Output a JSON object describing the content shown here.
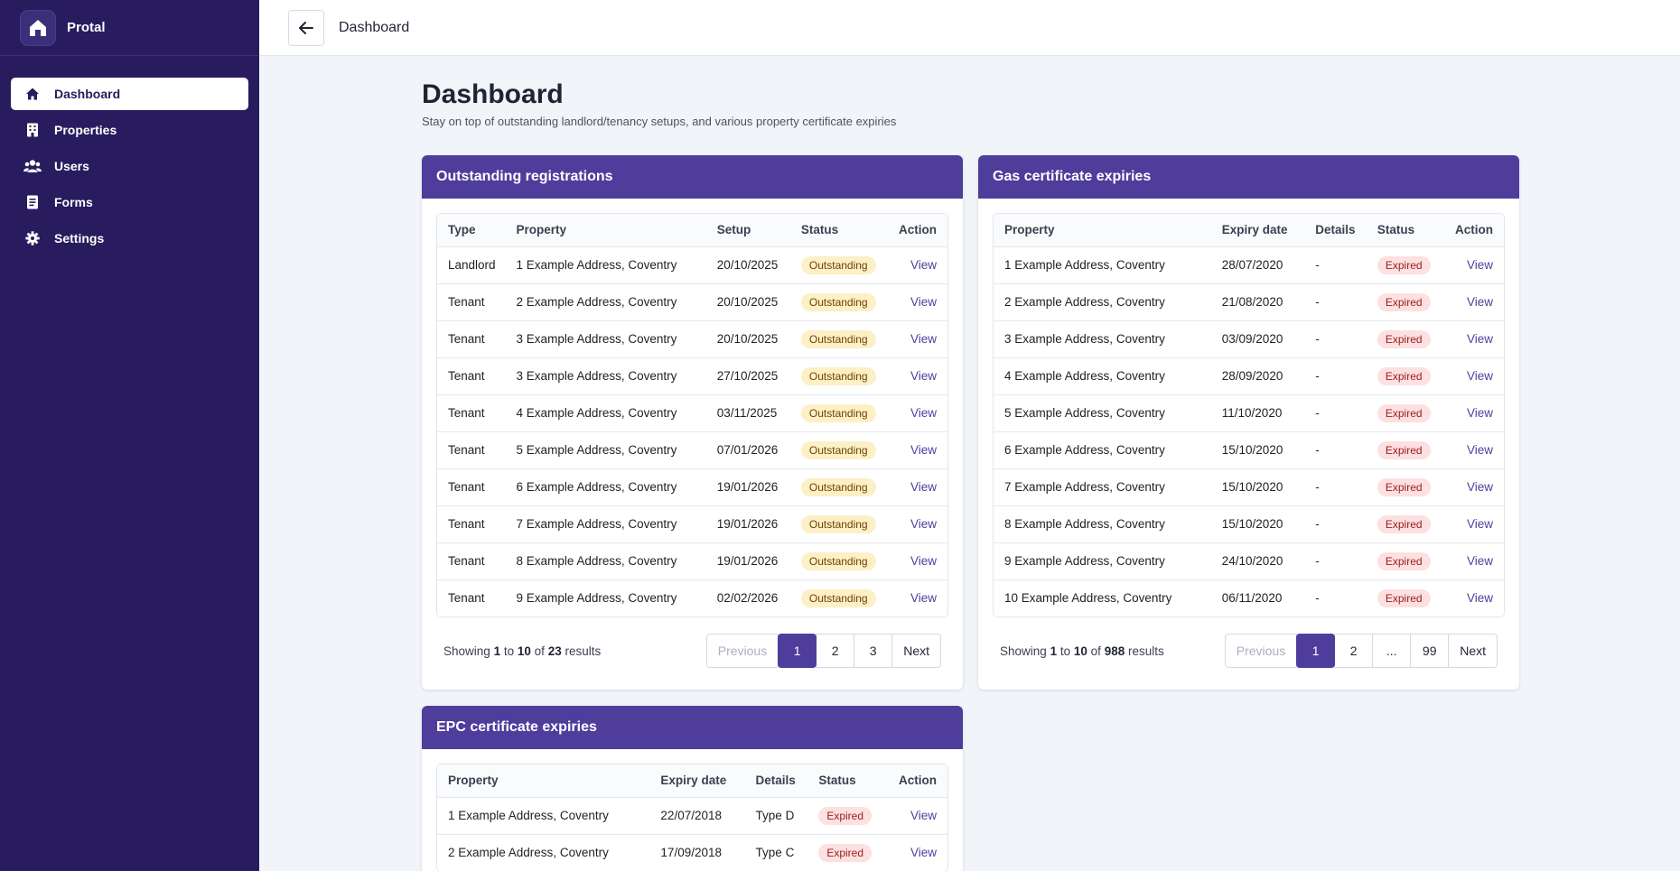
{
  "app": {
    "name": "Protal"
  },
  "sidebar": {
    "items": [
      {
        "label": "Dashboard",
        "icon": "home-icon"
      },
      {
        "label": "Properties",
        "icon": "building-icon"
      },
      {
        "label": "Users",
        "icon": "users-icon"
      },
      {
        "label": "Forms",
        "icon": "form-icon"
      },
      {
        "label": "Settings",
        "icon": "gear-icon"
      }
    ]
  },
  "topbar": {
    "title": "Dashboard"
  },
  "page": {
    "title": "Dashboard",
    "subtitle": "Stay on top of outstanding landlord/tenancy setups, and various property certificate expiries"
  },
  "registrations": {
    "title": "Outstanding registrations",
    "headers": [
      "Type",
      "Property",
      "Setup",
      "Status",
      "Action"
    ],
    "rows": [
      [
        "Landlord",
        "1 Example Address, Coventry",
        "20/10/2025",
        "Outstanding",
        "View"
      ],
      [
        "Tenant",
        "2 Example Address, Coventry",
        "20/10/2025",
        "Outstanding",
        "View"
      ],
      [
        "Tenant",
        "3 Example Address, Coventry",
        "20/10/2025",
        "Outstanding",
        "View"
      ],
      [
        "Tenant",
        "3 Example Address, Coventry",
        "27/10/2025",
        "Outstanding",
        "View"
      ],
      [
        "Tenant",
        "4 Example Address, Coventry",
        "03/11/2025",
        "Outstanding",
        "View"
      ],
      [
        "Tenant",
        "5 Example Address, Coventry",
        "07/01/2026",
        "Outstanding",
        "View"
      ],
      [
        "Tenant",
        "6 Example Address, Coventry",
        "19/01/2026",
        "Outstanding",
        "View"
      ],
      [
        "Tenant",
        "7 Example Address, Coventry",
        "19/01/2026",
        "Outstanding",
        "View"
      ],
      [
        "Tenant",
        "8 Example Address, Coventry",
        "19/01/2026",
        "Outstanding",
        "View"
      ],
      [
        "Tenant",
        "9 Example Address, Coventry",
        "02/02/2026",
        "Outstanding",
        "View"
      ]
    ],
    "footer": {
      "showing": "Showing",
      "from": "1",
      "to_word": "to",
      "to": "10",
      "of_word": "of",
      "total": "23",
      "results": "results"
    },
    "pager": [
      "Previous",
      "1",
      "2",
      "3",
      "Next"
    ]
  },
  "gas": {
    "title": "Gas certificate expiries",
    "headers": [
      "Property",
      "Expiry date",
      "Details",
      "Status",
      "Action"
    ],
    "rows": [
      [
        "1 Example Address, Coventry",
        "28/07/2020",
        "-",
        "Expired",
        "View"
      ],
      [
        "2 Example Address, Coventry",
        "21/08/2020",
        "-",
        "Expired",
        "View"
      ],
      [
        "3 Example Address, Coventry",
        "03/09/2020",
        "-",
        "Expired",
        "View"
      ],
      [
        "4 Example Address, Coventry",
        "28/09/2020",
        "-",
        "Expired",
        "View"
      ],
      [
        "5 Example Address, Coventry",
        "11/10/2020",
        "-",
        "Expired",
        "View"
      ],
      [
        "6 Example Address, Coventry",
        "15/10/2020",
        "-",
        "Expired",
        "View"
      ],
      [
        "7 Example Address, Coventry",
        "15/10/2020",
        "-",
        "Expired",
        "View"
      ],
      [
        "8 Example Address, Coventry",
        "15/10/2020",
        "-",
        "Expired",
        "View"
      ],
      [
        "9 Example Address, Coventry",
        "24/10/2020",
        "-",
        "Expired",
        "View"
      ],
      [
        "10 Example Address, Coventry",
        "06/11/2020",
        "-",
        "Expired",
        "View"
      ]
    ],
    "footer": {
      "showing": "Showing",
      "from": "1",
      "to_word": "to",
      "to": "10",
      "of_word": "of",
      "total": "988",
      "results": "results"
    },
    "pager": [
      "Previous",
      "1",
      "2",
      "...",
      "99",
      "Next"
    ]
  },
  "epc": {
    "title": "EPC certificate expiries",
    "headers": [
      "Property",
      "Expiry date",
      "Details",
      "Status",
      "Action"
    ],
    "rows": [
      [
        "1 Example Address, Coventry",
        "22/07/2018",
        "Type D",
        "Expired",
        "View"
      ],
      [
        "2 Example Address, Coventry",
        "17/09/2018",
        "Type C",
        "Expired",
        "View"
      ]
    ]
  },
  "colors": {
    "sidebar_bg": "#281c5e",
    "accent": "#4f3d9c",
    "outstanding_badge": "#fdefc6",
    "expired_badge": "#fde0e0"
  }
}
